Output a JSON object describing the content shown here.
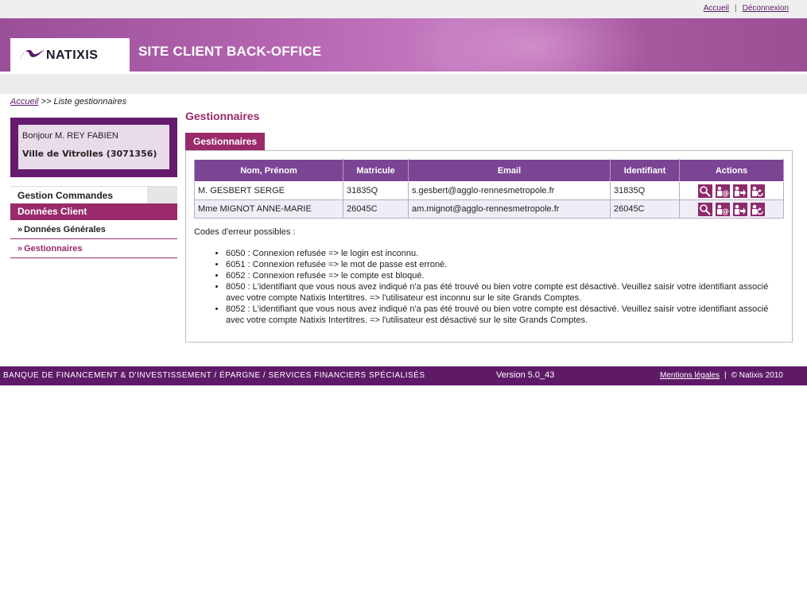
{
  "topnav": {
    "home": "Accueil",
    "separator": "|",
    "logout": "Déconnexion"
  },
  "header": {
    "logo_text": "NATIXIS",
    "site_title": "SITE CLIENT BACK-OFFICE"
  },
  "breadcrumb": {
    "home": "Accueil",
    "separator": ">>",
    "current": "Liste gestionnaires"
  },
  "user": {
    "greeting": "Bonjour M. REY FABIEN",
    "organization": "Ville de Vitrolles (3071356)"
  },
  "sidebar": {
    "section1": "Gestion Commandes",
    "section2": "Données Client",
    "items": [
      {
        "label": "Données Générales",
        "arrow": "»"
      },
      {
        "label": "Gestionnaires",
        "arrow": "»"
      }
    ]
  },
  "main": {
    "title": "Gestionnaires",
    "tab": "Gestionnaires",
    "table": {
      "headers": [
        "Nom, Prénom",
        "Matricule",
        "Email",
        "Identifiant",
        "Actions"
      ],
      "rows": [
        {
          "name": "M. GESBERT SERGE",
          "matricule": "31835Q",
          "email": "s.gesbert@agglo-rennesmetropole.fr",
          "identifiant": "31835Q"
        },
        {
          "name": "Mme MIGNOT ANNE-MARIE",
          "matricule": "26045C",
          "email": "am.mignot@agglo-rennesmetropole.fr",
          "identifiant": "26045C"
        }
      ],
      "action_icons": [
        "magnifier-icon",
        "user-email-icon",
        "user-arrow-icon",
        "user-refresh-icon"
      ]
    },
    "codes_title": "Codes d'erreur possibles :",
    "codes": [
      "6050 : Connexion refusée => le login est inconnu.",
      "6051 : Connexion refusée => le mot de passe est erroné.",
      "6052 : Connexion refusée => le compte est bloqué.",
      "8050 : L'identifiant que vous nous avez indiqué n'a pas été trouvé ou bien votre compte est désactivé. Veuillez saisir votre identifiant associé avec votre compte Natixis Intertitres. => l'utilisateur est inconnu sur le site Grands Comptes.",
      "8052 : L'identifiant que vous nous avez indiqué n'a pas été trouvé ou bien votre compte est désactivé. Veuillez saisir votre identifiant associé avec votre compte Natixis Intertitres. => l'utilisateur est désactivé sur le site Grands Comptes."
    ]
  },
  "footer": {
    "tagline": "BANQUE DE FINANCEMENT & D'INVESTISSEMENT / ÉPARGNE / SERVICES FINANCIERS SPÉCIALISÉS",
    "version": "Version 5.0_43",
    "legal": "Mentions légales",
    "separator": "|",
    "copyright": "© Natixis 2010"
  },
  "colors": {
    "brand_purple": "#651b6e",
    "accent_magenta": "#9a2a6b",
    "table_header": "#7b4594"
  }
}
